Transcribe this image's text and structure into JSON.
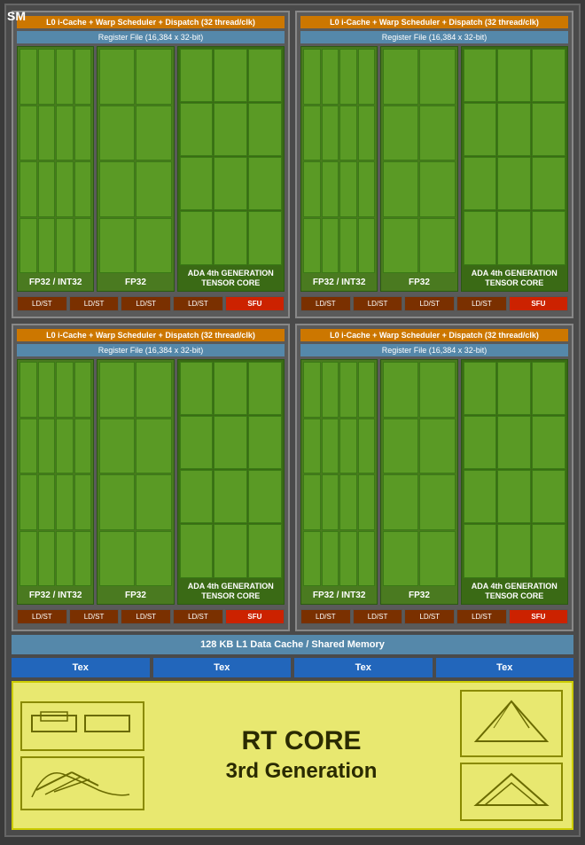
{
  "page": {
    "sm_label": "SM",
    "warp_scheduler": "L0 i-Cache + Warp Scheduler + Dispatch (32 thread/clk)",
    "register_file": "Register File (16,384 x 32-bit)",
    "fp32_int32_label": "FP32 / INT32",
    "fp32_label": "FP32",
    "tensor_label": "ADA 4th GENERATION TENSOR CORE",
    "ldst_label": "LD/ST",
    "sfu_label": "SFU",
    "l1_cache": "128 KB L1 Data Cache / Shared Memory",
    "tex_label": "Tex",
    "rt_core_line1": "RT CORE",
    "rt_core_line2": "3rd Generation"
  }
}
